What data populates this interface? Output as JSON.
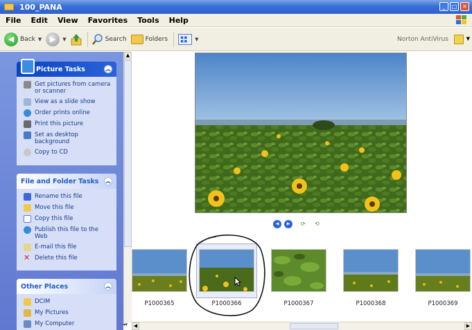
{
  "window": {
    "title": "100_PANA"
  },
  "menu": [
    "File",
    "Edit",
    "View",
    "Favorites",
    "Tools",
    "Help"
  ],
  "toolbar": {
    "back_label": "Back",
    "search_label": "Search",
    "folders_label": "Folders",
    "norton_label": "Norton AntiVirus"
  },
  "picture_tasks": {
    "title": "Picture Tasks",
    "items": [
      "Get pictures from camera or scanner",
      "View as a slide show",
      "Order prints online",
      "Print this picture",
      "Set as desktop background",
      "Copy to CD"
    ]
  },
  "file_tasks": {
    "title": "File and Folder Tasks",
    "items": [
      "Rename this file",
      "Move this file",
      "Copy this file",
      "Publish this file to the Web",
      "E-mail this file",
      "Delete this file"
    ]
  },
  "other_places": {
    "title": "Other Places",
    "items": [
      "DCIM",
      "My Pictures",
      "My Computer"
    ]
  },
  "filmstrip": {
    "items": [
      {
        "name": "P1000365",
        "kind": "landscape"
      },
      {
        "name": "P1000366",
        "kind": "sunflowers-sky",
        "selected": true
      },
      {
        "name": "P1000367",
        "kind": "closeup"
      },
      {
        "name": "P1000368",
        "kind": "landscape"
      },
      {
        "name": "P1000369",
        "kind": "landscape"
      }
    ]
  },
  "colors": {
    "title_bar": "#2e5fcf",
    "task_pane": "#6078d0",
    "task_link": "#1a3a8a"
  }
}
